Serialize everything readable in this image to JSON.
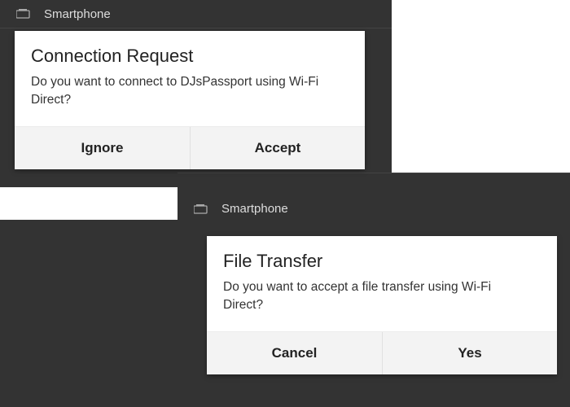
{
  "background": {
    "top_list_item": "Smartphone",
    "mid_list_item": "Smartphone"
  },
  "dialog1": {
    "title": "Connection Request",
    "body": "Do you want to connect to DJsPassport using Wi-Fi Direct?",
    "left_button": "Ignore",
    "right_button": "Accept"
  },
  "dialog2": {
    "title": "File Transfer",
    "body": "Do you want to accept a file transfer using Wi-Fi Direct?",
    "left_button": "Cancel",
    "right_button": "Yes"
  },
  "colors": {
    "phone_bg": "#333333",
    "dialog_bg": "#ffffff",
    "button_bg": "#f3f3f3"
  }
}
